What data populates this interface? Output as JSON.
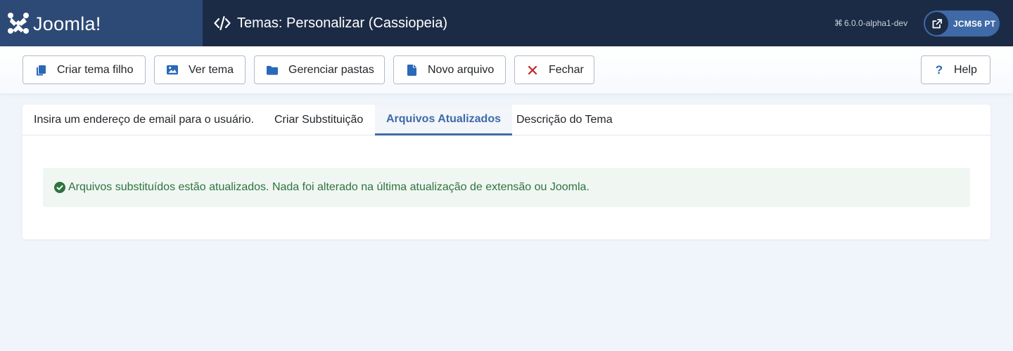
{
  "header": {
    "logo_text": "Joomla!",
    "title": "Temas: Personalizar (Cassiopeia)",
    "title_icon": "code-icon",
    "version": "6.0.0-alpha1-dev",
    "version_icon": "joomla-mini-icon",
    "site_button_label": "JCMS6 PT",
    "site_button_icon": "external-link-icon"
  },
  "toolbar": {
    "buttons": [
      {
        "label": "Criar tema filho",
        "icon": "copy-icon"
      },
      {
        "label": "Ver tema",
        "icon": "image-icon"
      },
      {
        "label": "Gerenciar pastas",
        "icon": "folder-icon"
      },
      {
        "label": "Novo arquivo",
        "icon": "file-icon"
      },
      {
        "label": "Fechar",
        "icon": "close-icon"
      }
    ],
    "help_label": "Help",
    "help_icon": "question-icon"
  },
  "tabs": [
    {
      "label": "Insira um endereço de email para o usuário.",
      "active": false
    },
    {
      "label": "Criar Substituição",
      "active": false
    },
    {
      "label": "Arquivos Atualizados",
      "active": true
    },
    {
      "label": "Descrição do Tema",
      "active": false
    }
  ],
  "alert": {
    "message": "Arquivos substituídos estão atualizados. Nada foi alterado na última atualização de extensão ou Joomla.",
    "icon": "check-circle-icon"
  },
  "colors": {
    "header_bg": "#1c2b45",
    "logo_bg": "#2c4a75",
    "accent": "#3f6aa7",
    "icon_blue": "#2a69b8",
    "close_red": "#c52827",
    "success_text": "#2e7340",
    "success_bg": "#f0f6f2",
    "page_bg": "#f0f4fb"
  }
}
